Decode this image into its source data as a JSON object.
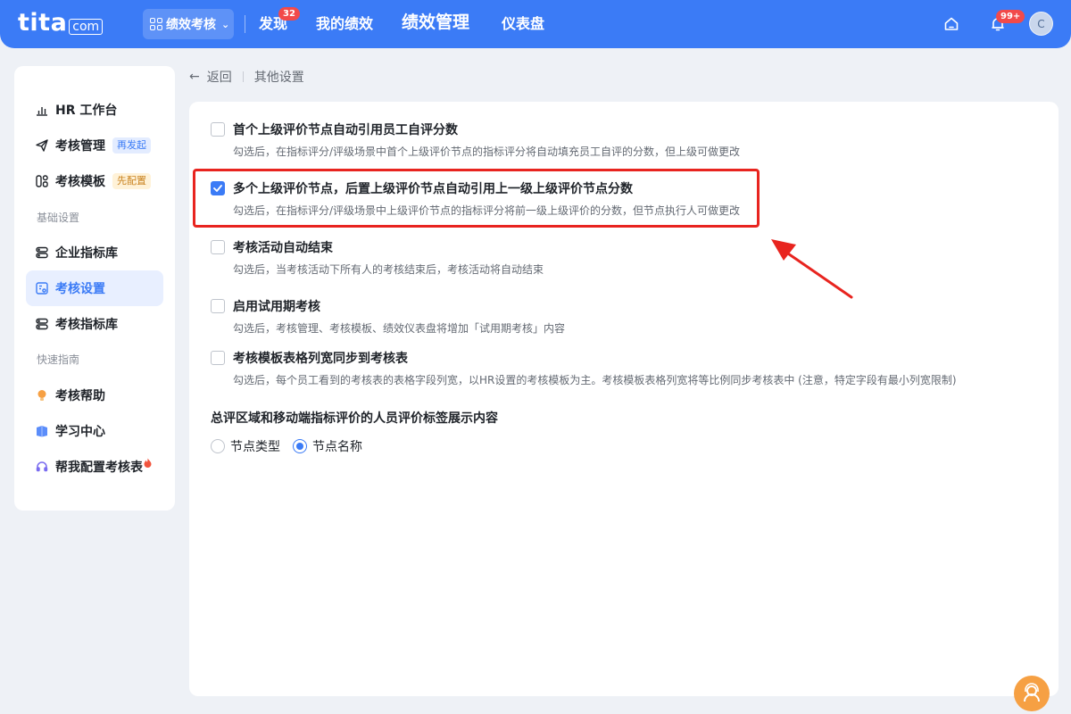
{
  "header": {
    "logo_main": "tita",
    "logo_suffix": "com",
    "module_switch": "绩效考核",
    "nav": [
      {
        "label": "发现",
        "badge": "32"
      },
      {
        "label": "我的绩效"
      },
      {
        "label": "绩效管理",
        "active": true
      },
      {
        "label": "仪表盘"
      }
    ],
    "notification_badge": "99+",
    "avatar_initial": "C",
    "icons": [
      "home-icon",
      "bell-icon"
    ]
  },
  "sidebar": {
    "items": [
      {
        "label": "HR 工作台",
        "icon": "bar-chart-icon"
      },
      {
        "label": "考核管理",
        "icon": "send-icon",
        "tag": "再发起"
      },
      {
        "label": "考核模板",
        "icon": "template-icon",
        "tag": "先配置"
      },
      {
        "label": "企业指标库",
        "icon": "library-icon"
      },
      {
        "label": "考核设置",
        "icon": "settings-doc-icon",
        "active": true
      },
      {
        "label": "考核指标库",
        "icon": "library-icon"
      },
      {
        "label": "考核帮助",
        "icon": "bulb-icon"
      },
      {
        "label": "学习中心",
        "icon": "book-icon"
      },
      {
        "label": "帮我配置考核表",
        "icon": "headset-icon"
      }
    ],
    "sections": [
      "基础设置",
      "快速指南"
    ]
  },
  "breadcrumb": {
    "back": "返回",
    "current": "其他设置"
  },
  "options": [
    {
      "title": "首个上级评价节点自动引用员工自评分数",
      "desc": "勾选后，在指标评分/评级场景中首个上级评价节点的指标评分将自动填充员工自评的分数，但上级可做更改",
      "checked": false
    },
    {
      "title": "多个上级评价节点，后置上级评价节点自动引用上一级上级评价节点分数",
      "desc": "勾选后，在指标评分/评级场景中上级评价节点的指标评分将前一级上级评价的分数，但节点执行人可做更改",
      "checked": true
    },
    {
      "title": "考核活动自动结束",
      "desc": "勾选后，当考核活动下所有人的考核结束后，考核活动将自动结束",
      "checked": false
    },
    {
      "title": "启用试用期考核",
      "desc": "勾选后，考核管理、考核模板、绩效仪表盘将增加「试用期考核」内容",
      "checked": false
    },
    {
      "title": "考核模板表格列宽同步到考核表",
      "desc": "勾选后，每个员工看到的考核表的表格字段列宽，以HR设置的考核模板为主。考核模板表格列宽将等比例同步考核表中 (注意，特定字段有最小列宽限制)",
      "checked": false
    }
  ],
  "label_display": {
    "title": "总评区域和移动端指标评价的人员评价标签展示内容",
    "radios": [
      {
        "label": "节点类型",
        "selected": false
      },
      {
        "label": "节点名称",
        "selected": true
      }
    ]
  },
  "colors": {
    "primary": "#3b7bf6",
    "highlight": "#e8241f",
    "fab": "#f6a043"
  }
}
